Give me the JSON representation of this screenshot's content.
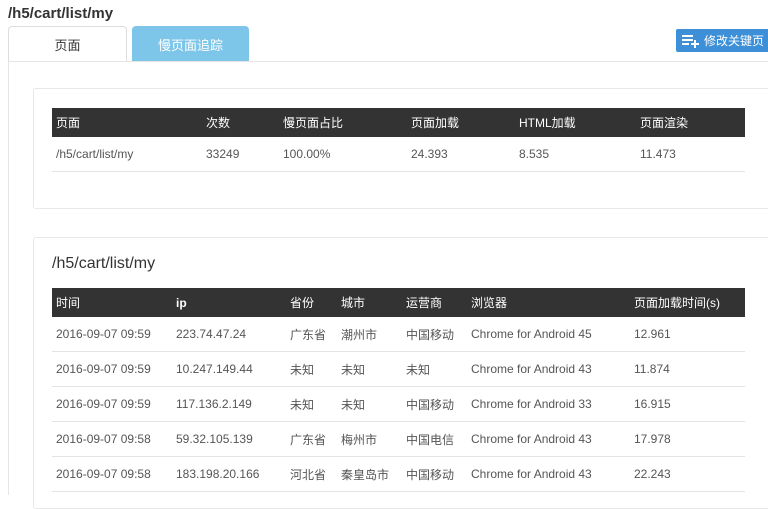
{
  "header": {
    "title": "/h5/cart/list/my"
  },
  "tabs": [
    {
      "label": "页面"
    },
    {
      "label": "慢页面追踪"
    }
  ],
  "toolbar": {
    "edit_label": "修改关键页"
  },
  "summary_table": {
    "headers": [
      "页面",
      "次数",
      "慢页面占比",
      "页面加载",
      "HTML加载",
      "页面渲染"
    ],
    "rows": [
      [
        "/h5/cart/list/my",
        "33249",
        "100.00%",
        "24.393",
        "8.535",
        "11.473"
      ]
    ]
  },
  "detail": {
    "title": "/h5/cart/list/my",
    "headers": [
      "时间",
      "ip",
      "省份",
      "城市",
      "运营商",
      "浏览器",
      "页面加载时间(s)"
    ],
    "rows": [
      [
        "2016-09-07 09:59",
        "223.74.47.24",
        "广东省",
        "潮州市",
        "中国移动",
        "Chrome for Android 45",
        "12.961"
      ],
      [
        "2016-09-07 09:59",
        "10.247.149.44",
        "未知",
        "未知",
        "未知",
        "Chrome for Android 43",
        "11.874"
      ],
      [
        "2016-09-07 09:59",
        "117.136.2.149",
        "未知",
        "未知",
        "中国移动",
        "Chrome for Android 33",
        "16.915"
      ],
      [
        "2016-09-07 09:58",
        "59.32.105.139",
        "广东省",
        "梅州市",
        "中国电信",
        "Chrome for Android 43",
        "17.978"
      ],
      [
        "2016-09-07 09:58",
        "183.198.20.166",
        "河北省",
        "秦皇岛市",
        "中国移动",
        "Chrome for Android 43",
        "22.243"
      ]
    ]
  },
  "icons": {
    "edit": "list-add-icon"
  },
  "colors": {
    "tab_active": "#7dc6ea",
    "button": "#3d8fd8",
    "table_header": "#333333"
  }
}
